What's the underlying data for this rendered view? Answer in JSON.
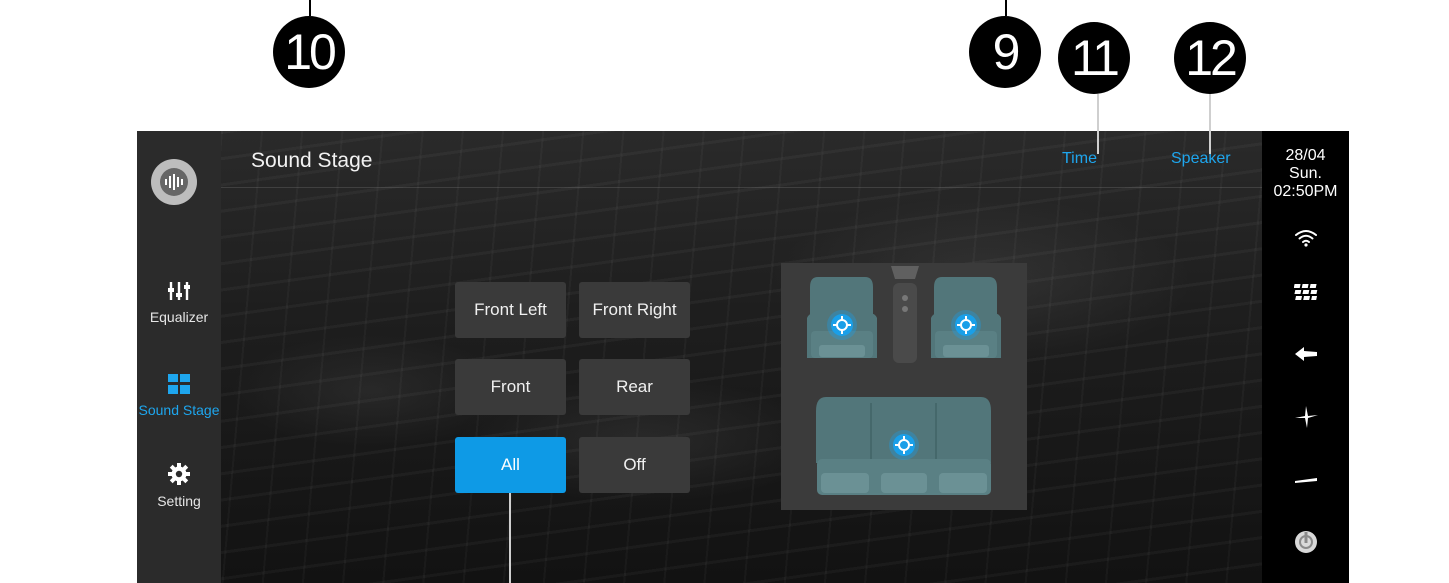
{
  "callouts": {
    "c10": "10",
    "c9": "9",
    "c11": "11",
    "c12": "12"
  },
  "sidebar": {
    "logo": "waveform-icon",
    "items": [
      {
        "label": "Equalizer",
        "icon": "equalizer-sliders-icon",
        "active": false
      },
      {
        "label": "Sound Stage",
        "icon": "grid-icon",
        "active": true
      },
      {
        "label": "Setting",
        "icon": "gear-icon",
        "active": false
      }
    ]
  },
  "header": {
    "title": "Sound Stage",
    "time_label": "Time",
    "speaker_label": "Speaker"
  },
  "status": {
    "date": "28/04",
    "day": "Sun.",
    "time": "02:50PM",
    "icons": [
      "wifi-icon",
      "app-grid-icon",
      "back-arrow-icon",
      "volume-plus-icon",
      "volume-minus-icon",
      "power-icon"
    ]
  },
  "sound_stage": {
    "buttons": [
      "Front Left",
      "Front Right",
      "Front",
      "Rear",
      "All",
      "Off"
    ],
    "selected": "All"
  },
  "colors": {
    "accent": "#1ea6ee",
    "selected_button": "#0e9ae6",
    "seat": "#4f6f72"
  }
}
